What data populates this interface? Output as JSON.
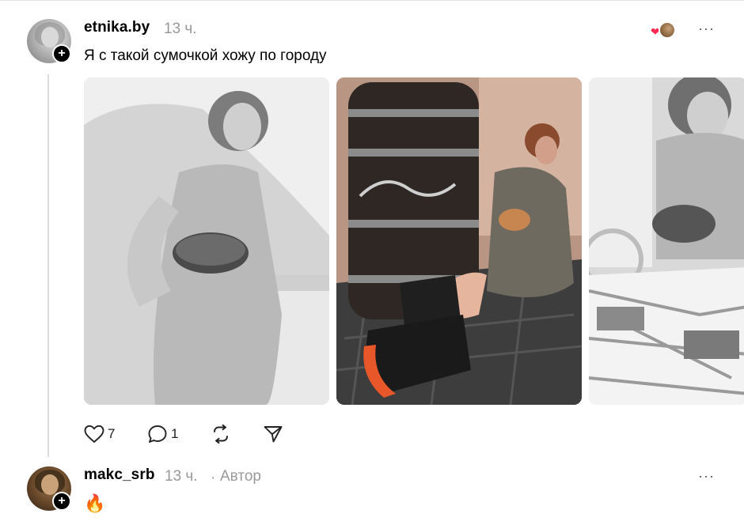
{
  "post": {
    "username": "etnika.by",
    "time": "13 ч.",
    "text": "Я с такой сумочкой хожу по городу",
    "follow_glyph": "+",
    "more_label": "···",
    "likers_icon": "heart-icon",
    "images": [
      {
        "icon": "photo-woman-dress-handbag"
      },
      {
        "icon": "photo-barrel-boots"
      },
      {
        "icon": "photo-woman-newspaper"
      }
    ],
    "actions": {
      "likes": "7",
      "replies": "1"
    }
  },
  "reply": {
    "username": "makc_srb",
    "time": "13 ч.",
    "separator": "·",
    "author_tag": "Автор",
    "follow_glyph": "+",
    "more_label": "···",
    "text": "🔥"
  },
  "colors": {
    "accent_heart": "#ff2850",
    "muted_text": "#999999",
    "thread_line": "#dcdcdc"
  }
}
